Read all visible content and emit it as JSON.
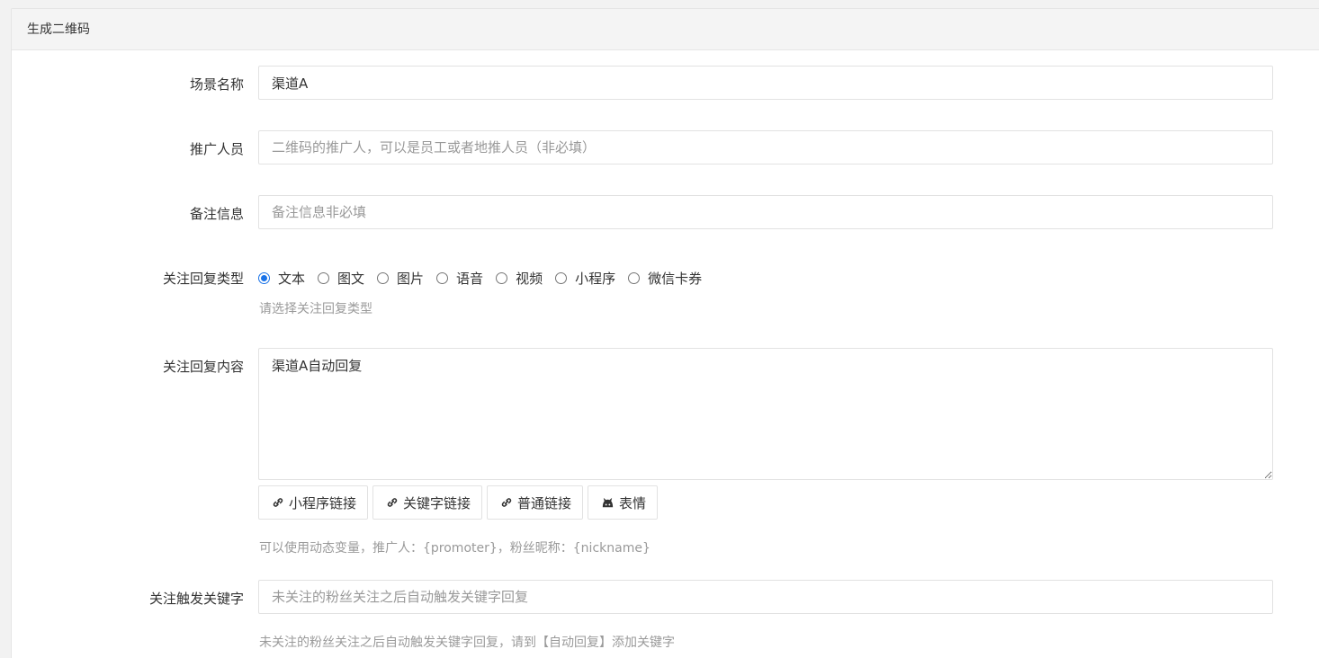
{
  "header": {
    "title": "生成二维码"
  },
  "form": {
    "scene": {
      "label": "场景名称",
      "value": "渠道A",
      "placeholder": ""
    },
    "promoter": {
      "label": "推广人员",
      "value": "",
      "placeholder": "二维码的推广人，可以是员工或者地推人员（非必填）"
    },
    "remark": {
      "label": "备注信息",
      "value": "",
      "placeholder": "备注信息非必填"
    },
    "reply_type": {
      "label": "关注回复类型",
      "options": [
        "文本",
        "图文",
        "图片",
        "语音",
        "视频",
        "小程序",
        "微信卡券"
      ],
      "selected": "文本",
      "hint": "请选择关注回复类型"
    },
    "reply_content": {
      "label": "关注回复内容",
      "value": "渠道A自动回复",
      "buttons": [
        {
          "label": "小程序链接",
          "icon": "link-icon"
        },
        {
          "label": "关键字链接",
          "icon": "link-icon"
        },
        {
          "label": "普通链接",
          "icon": "link-icon"
        },
        {
          "label": "表情",
          "icon": "github-cat-icon"
        }
      ],
      "hint": "可以使用动态变量，推广人：{promoter}，粉丝昵称：{nickname}"
    },
    "trigger_keyword": {
      "label": "关注触发关键字",
      "value": "",
      "placeholder": "未关注的粉丝关注之后自动触发关键字回复",
      "hint": "未关注的粉丝关注之后自动触发关键字回复，请到【自动回复】添加关键字"
    }
  },
  "colors": {
    "accent": "#1a73e8",
    "hint": "#9a9a9a",
    "border": "#e2e2e2"
  }
}
